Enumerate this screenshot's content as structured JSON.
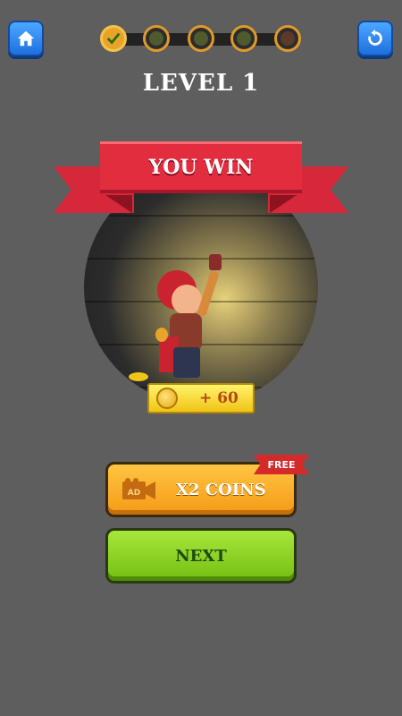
{
  "header": {
    "home_icon": "home-icon",
    "restart_icon": "restart-icon",
    "level_title": "LEVEL 1",
    "stages": [
      {
        "state": "completed"
      },
      {
        "state": "locked"
      },
      {
        "state": "locked"
      },
      {
        "state": "locked"
      },
      {
        "state": "boss"
      }
    ]
  },
  "result": {
    "banner_text": "YOU WIN",
    "reward_text": "+ 60"
  },
  "buttons": {
    "x2_coins_label": "X2 COINS",
    "ad_badge": "AD",
    "free_tag": "FREE",
    "next_label": "NEXT"
  },
  "colors": {
    "background": "#5e5e5e",
    "banner_red": "#e12d3e",
    "x2_orange": "#f59a16",
    "next_green": "#74bf12",
    "top_button_blue": "#1f6fe0"
  }
}
